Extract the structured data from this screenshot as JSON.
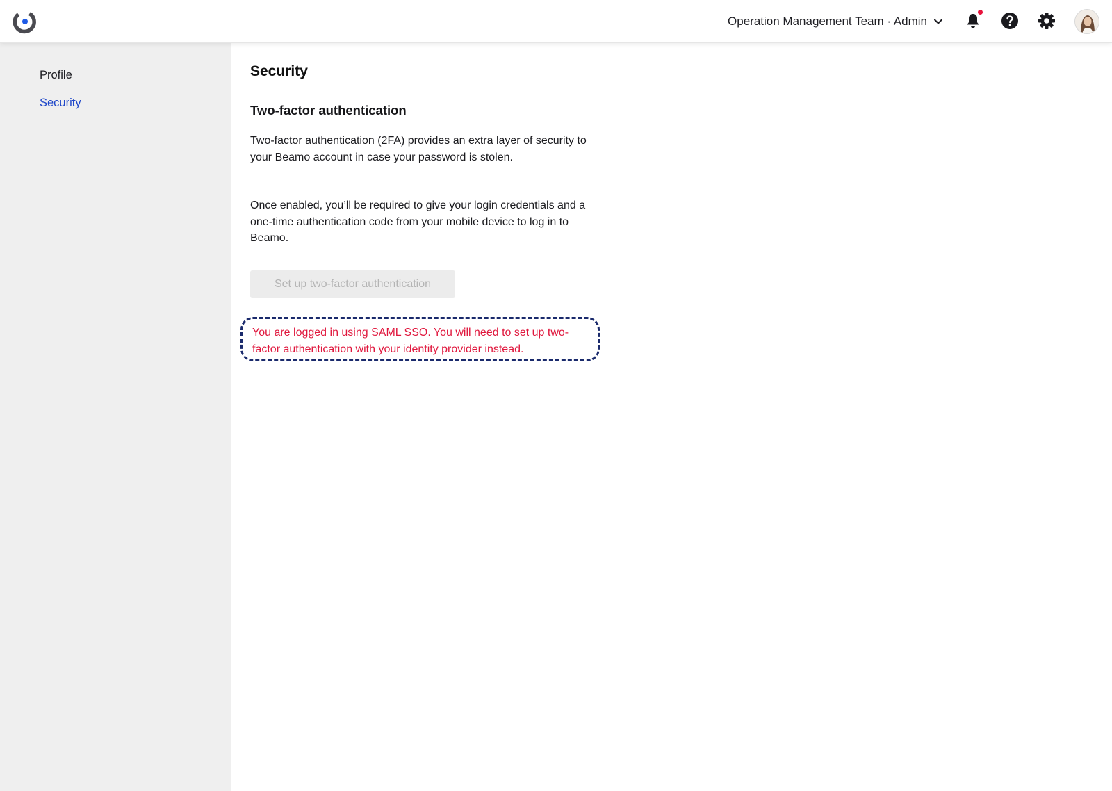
{
  "header": {
    "team_label": "Operation Management Team · Admin",
    "icons": {
      "logo": "beamo-logo-icon",
      "dropdown": "chevron-down-icon",
      "notifications": "bell-icon",
      "help": "help-circle-icon",
      "settings": "gear-icon"
    },
    "notification_dot_color": "#e8133c"
  },
  "sidebar": {
    "items": [
      {
        "label": "Profile",
        "active": false
      },
      {
        "label": "Security",
        "active": true
      }
    ],
    "active_color": "#1f47c9"
  },
  "main": {
    "title": "Security",
    "section_title": "Two-factor authentication",
    "paragraph_1": "Two-factor authentication (2FA) provides an extra layer of security to your Beamo account in case your password is stolen.",
    "paragraph_2": "Once enabled, you’ll be required to give your login credentials and a one-time authentication code from your mobile device to log in to Beamo.",
    "setup_button_label": "Set up two-factor authentication",
    "setup_button_disabled": true,
    "sso_notice": "You are logged in using SAML SSO. You will need to set up two-factor authentication with your identity provider instead.",
    "sso_notice_color": "#e0173d",
    "notice_border_color": "#1a2a6c"
  }
}
